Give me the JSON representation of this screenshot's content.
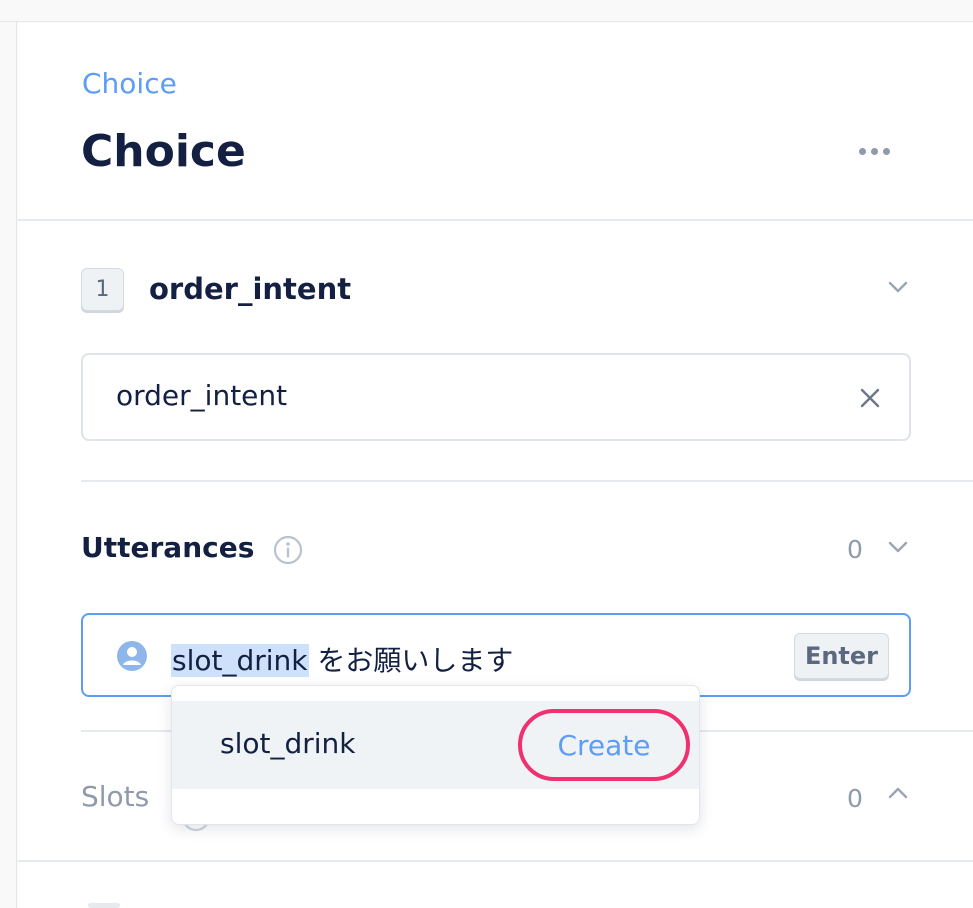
{
  "header": {
    "breadcrumb": "Choice",
    "title": "Choice",
    "more_icon": "more-horizontal-icon"
  },
  "intent": {
    "step_number": "1",
    "title": "order_intent",
    "input_value": "order_intent",
    "clear_icon": "close-icon",
    "collapse_icon": "chevron-down-icon"
  },
  "utterances": {
    "title": "Utterances",
    "info_icon": "info-icon",
    "count": "0",
    "input": {
      "user_icon": "user-icon",
      "slot_token": "slot_drink",
      "text_after": " をお願いします",
      "enter_label": "Enter"
    }
  },
  "dropdown": {
    "item_label": "slot_drink",
    "create_label": "Create"
  },
  "slots": {
    "title": "Slots",
    "count": "0",
    "expand_icon": "chevron-up-icon"
  },
  "colors": {
    "accent": "#5d9df5",
    "text": "#132042",
    "muted": "#8f9bab",
    "highlight_ring": "#f0306f",
    "slot_highlight": "#cde1fb"
  }
}
